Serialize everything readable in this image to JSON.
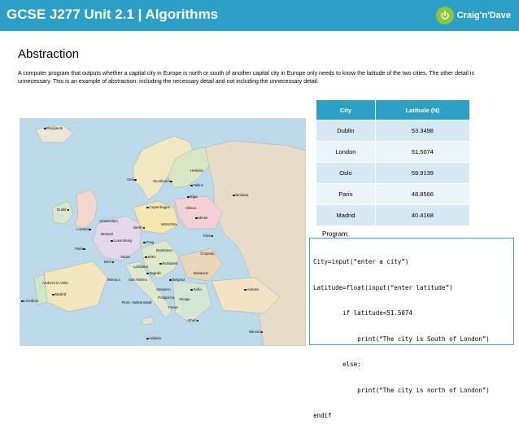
{
  "header": {
    "title": "GCSE J277 Unit 2.1 | Algorithms",
    "logo_text": "Craig'n'Dave",
    "color": "#2c9fc7"
  },
  "page": {
    "title": "Abstraction",
    "description": "A computer program that outputs whether a capital city in Europe is north or south of another capital city in Europe only needs to know the latitude of the two cities.  The other detail is unnecessary.  This is an example of abstraction: including the necessary detail and not including the unnecessary detail."
  },
  "table": {
    "headers": [
      "City",
      "Latitude (N)"
    ],
    "rows": [
      [
        "Dublin",
        "53.3498"
      ],
      [
        "London",
        "51.5074"
      ],
      [
        "Oslo",
        "59.9139"
      ],
      [
        "Paris",
        "48.8566"
      ],
      [
        "Madrid",
        "40.4168"
      ]
    ]
  },
  "program": {
    "label": "Program:",
    "lines": [
      "City=input(“enter a city”)",
      "Latitude=float(input(“enter latitude”)",
      "        if latitude<51.5074",
      "            print(“The city is South of London”)",
      "        else:",
      "            print(“The city is north of London”)",
      "endif"
    ]
  },
  "map": {
    "cities": [
      "Reykjavík",
      "Oslo",
      "Stockholm",
      "Helsinki",
      "Tallinn",
      "Riga",
      "Moskau",
      "Copenhagen",
      "Vilnius",
      "Dublin",
      "Minsk",
      "Amsterdam",
      "Berlin",
      "Warschau",
      "London",
      "Brüssel",
      "Luxemburg",
      "Prag",
      "Kiew",
      "Paris",
      "Vaduz",
      "Wien",
      "Bratislava",
      "Chişinău",
      "Bern",
      "Ljubljana",
      "Budapest",
      "Andorra la Vella",
      "Monaco",
      "Zagreb",
      "Belgrad",
      "Bukarest",
      "San Marino",
      "Sarajevo",
      "Sofia",
      "Madrid",
      "Rom, Vatikanstadt",
      "Podgorica",
      "Skopje",
      "Lissabon",
      "Tirana",
      "Ankara",
      "Athen",
      "Valletta",
      "Nikosia"
    ]
  }
}
